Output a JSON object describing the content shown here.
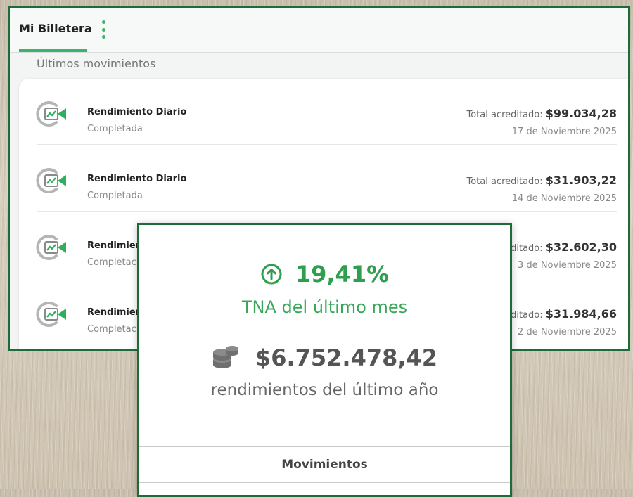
{
  "wallet": {
    "title": "Mi Billetera",
    "section_title": "Últimos movimientos",
    "accent_color": "#3db26b",
    "movements": [
      {
        "name": "Rendimiento Diario",
        "status": "Completada",
        "amount_label": "Total acreditado: ",
        "amount": "$99.034,28",
        "date": "17 de Noviembre 2025",
        "icon": "yield-chart-icon"
      },
      {
        "name": "Rendimiento Diario",
        "status": "Completada",
        "amount_label": "Total acreditado: ",
        "amount": "$31.903,22",
        "date": "14 de Noviembre 2025",
        "icon": "yield-chart-icon"
      },
      {
        "name": "Rendimien",
        "status": "Completac",
        "amount_label": "ditado: ",
        "amount": "$32.602,30",
        "date": "3 de Noviembre 2025",
        "icon": "yield-chart-icon"
      },
      {
        "name": "Rendimien",
        "status": "Completac",
        "amount_label": "ditado: ",
        "amount": "$31.984,66",
        "date": "2 de Noviembre 2025",
        "icon": "yield-chart-icon"
      }
    ]
  },
  "summary": {
    "tna_value": "19,41%",
    "tna_label": "TNA del último mes",
    "yield_amount": "$6.752.478,42",
    "yield_label": "rendimientos del último año",
    "button_label": "Movimientos",
    "tna_icon": "arrow-up-circle-icon",
    "amount_icon": "coins-stack-icon"
  }
}
